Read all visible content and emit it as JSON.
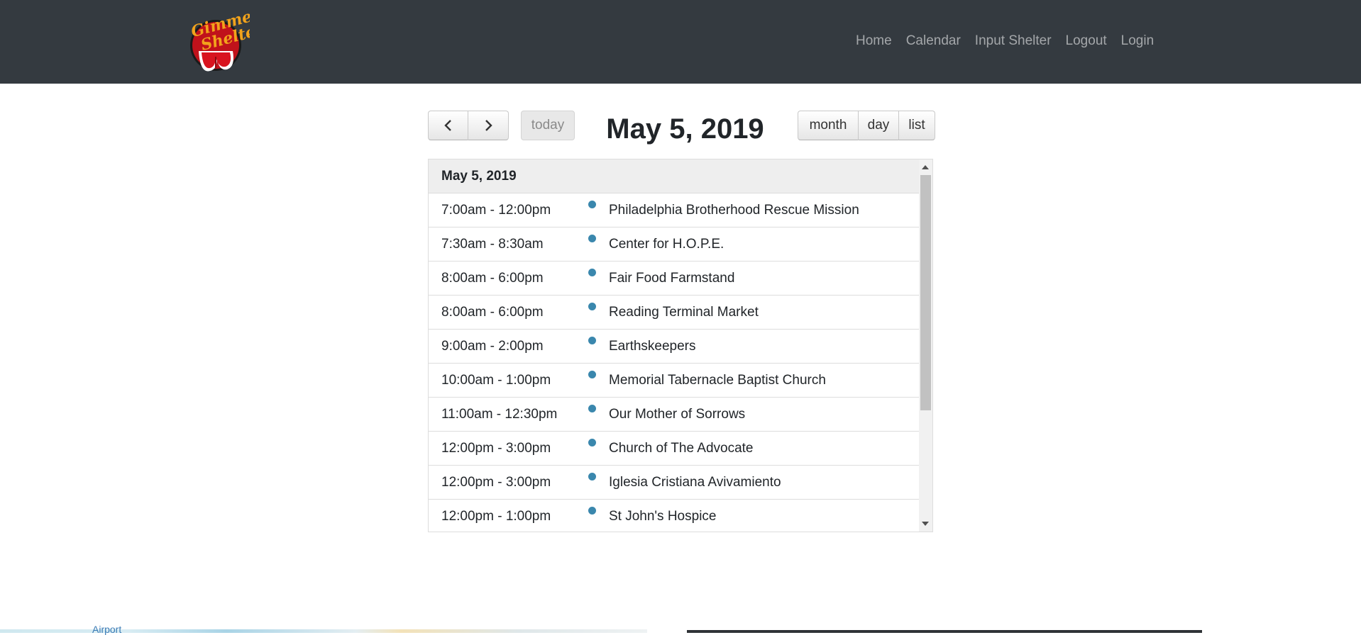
{
  "brand": {
    "logo_line1": "Gimme",
    "logo_line2": "Shelter"
  },
  "nav": {
    "items": [
      "Home",
      "Calendar",
      "Input Shelter",
      "Logout",
      "Login"
    ]
  },
  "calendar": {
    "title": "May 5, 2019",
    "today_label": "today",
    "views": {
      "month": "month",
      "day": "day",
      "list": "list"
    },
    "day_header": "May 5, 2019",
    "events": [
      {
        "time": "7:00am - 12:00pm",
        "title": "Philadelphia Brotherhood Rescue Mission"
      },
      {
        "time": "7:30am - 8:30am",
        "title": "Center for H.O.P.E."
      },
      {
        "time": "8:00am - 6:00pm",
        "title": "Fair Food Farmstand"
      },
      {
        "time": "8:00am - 6:00pm",
        "title": "Reading Terminal Market"
      },
      {
        "time": "9:00am - 2:00pm",
        "title": "Earthskeepers"
      },
      {
        "time": "10:00am - 1:00pm",
        "title": "Memorial Tabernacle Baptist Church"
      },
      {
        "time": "11:00am - 12:30pm",
        "title": "Our Mother of Sorrows"
      },
      {
        "time": "12:00pm - 3:00pm",
        "title": "Church of The Advocate"
      },
      {
        "time": "12:00pm - 3:00pm",
        "title": "Iglesia Cristiana Avivamiento"
      },
      {
        "time": "12:00pm - 1:00pm",
        "title": "St John's Hospice"
      }
    ],
    "event_dot_color": "#3a87ad"
  },
  "footer_map": {
    "label": "Airport"
  }
}
